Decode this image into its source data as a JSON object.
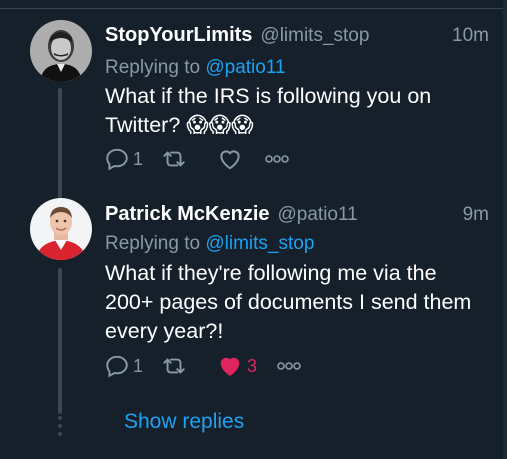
{
  "tweets": [
    {
      "name": "StopYourLimits",
      "handle": "@limits_stop",
      "time": "10m",
      "reply_prefix": "Replying to ",
      "reply_to": "@patio11",
      "text": "What if the IRS is following you on Twitter? 😱😱😱",
      "reply_count": "1",
      "retweet_count": "",
      "like_count": "",
      "liked": false,
      "avatar": "grayscale portrait of man with mustache"
    },
    {
      "name": "Patrick McKenzie",
      "handle": "@patio11",
      "time": "9m",
      "reply_prefix": "Replying to ",
      "reply_to": "@limits_stop",
      "text": "What if they're following me via the 200+ pages of documents I send them every year?!",
      "reply_count": "1",
      "retweet_count": "",
      "like_count": "3",
      "liked": true,
      "avatar": "man in red jacket smiling"
    }
  ],
  "show_replies": "Show replies",
  "colors": {
    "background": "#15202b",
    "text": "#ffffff",
    "secondary": "#8899a6",
    "accent": "#1da1f2",
    "like": "#e0245e"
  }
}
